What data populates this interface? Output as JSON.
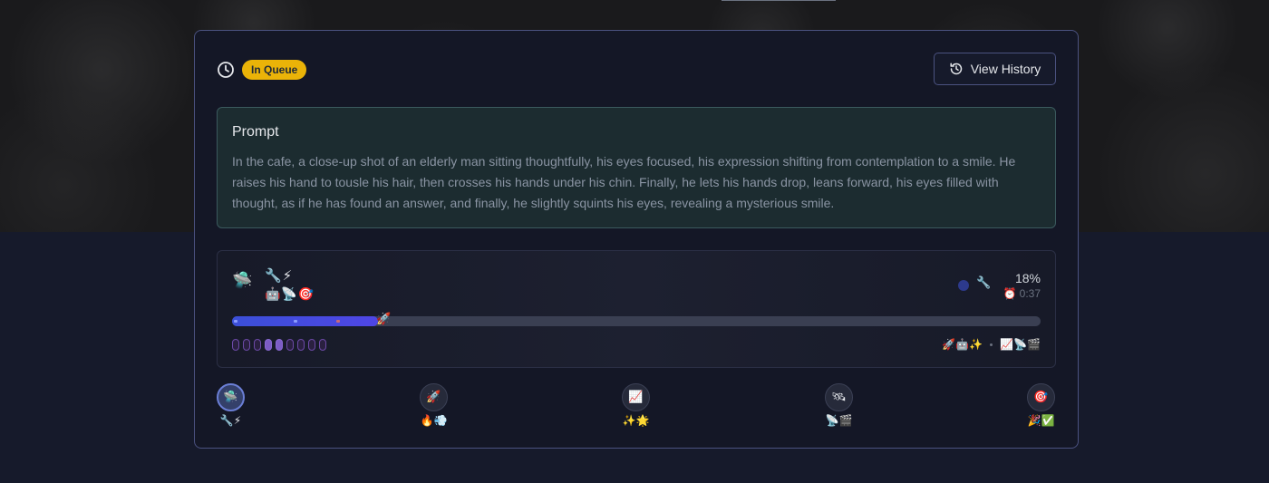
{
  "status": {
    "icon": "clock-icon",
    "badge_label": "In Queue",
    "badge_color": "#eab308"
  },
  "header": {
    "history_button_label": "View History",
    "history_icon": "history-icon"
  },
  "prompt": {
    "title": "Prompt",
    "text": "In the cafe, a close-up shot of an elderly man sitting thoughtfully, his eyes focused, his expression shifting from contemplation to a smile. He raises his hand to tousle his hair, then crosses his hands under his chin. Finally, he lets his hands drop, leans forward, his eyes filled with thought, as if he has found an answer, and finally, he slightly squints his eyes, revealing a mysterious smile."
  },
  "progress": {
    "stage_icon": "🛸",
    "tools_line1": "🔧⚡",
    "tools_line2": "🤖📡🎯",
    "indicator_icon": "🔧",
    "percent_label": "18%",
    "percent_value": 18,
    "time_icon": "⏰",
    "time_label": "0:37",
    "marker_icon": "🚀",
    "pills_total": 9,
    "pills_active": [
      4,
      5
    ],
    "right_icons_a": "🚀🤖✨",
    "right_icons_b": "📈📡🎬",
    "accent_color": "#4f46e5"
  },
  "steps": [
    {
      "icon": "🛸",
      "sub": "🔧⚡",
      "current": true
    },
    {
      "icon": "🚀",
      "sub": "🔥💨",
      "current": false
    },
    {
      "icon": "📈",
      "sub": "✨🌟",
      "current": false
    },
    {
      "icon": "🛰",
      "sub": "📡🎬",
      "current": false
    },
    {
      "icon": "🎯",
      "sub": "🎉✅",
      "current": false
    }
  ]
}
